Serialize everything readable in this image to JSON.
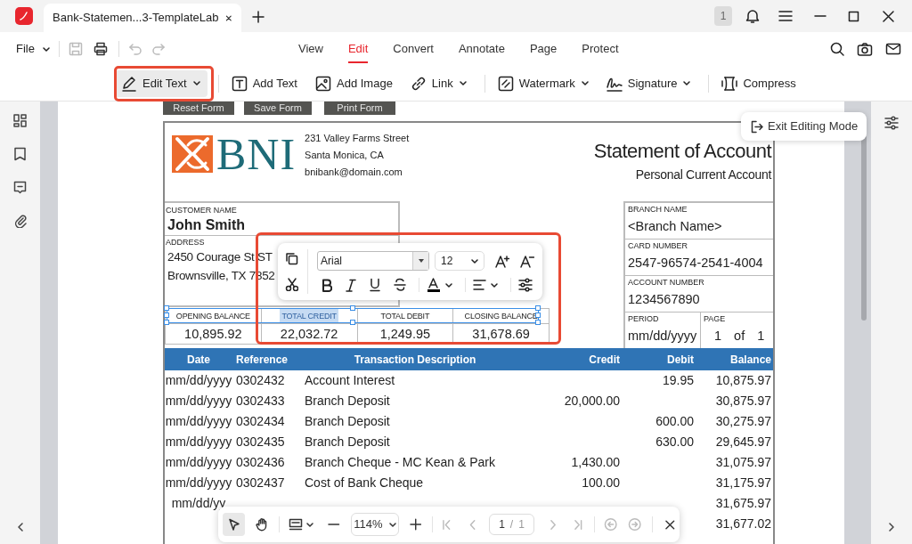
{
  "tab": {
    "title": "Bank-Statemen...3-TemplateLab",
    "notification_count": "1"
  },
  "menu": {
    "file": "File",
    "tabs": [
      {
        "label": "View",
        "selected": false
      },
      {
        "label": "Edit",
        "selected": true
      },
      {
        "label": "Convert",
        "selected": false
      },
      {
        "label": "Annotate",
        "selected": false
      },
      {
        "label": "Page",
        "selected": false
      },
      {
        "label": "Protect",
        "selected": false
      }
    ]
  },
  "toolbar": [
    {
      "label": "Edit Text",
      "kind": "pencil",
      "dropdown": true,
      "selected": true
    },
    {
      "label": "Add Text",
      "kind": "textbox",
      "dropdown": false,
      "selected": false
    },
    {
      "label": "Add Image",
      "kind": "image",
      "dropdown": false,
      "selected": false
    },
    {
      "label": "Link",
      "kind": "link",
      "dropdown": true,
      "selected": false
    },
    {
      "label": "Watermark",
      "kind": "watermark",
      "dropdown": true,
      "selected": false
    },
    {
      "label": "Signature",
      "kind": "signature",
      "dropdown": true,
      "selected": false
    },
    {
      "label": "Compress",
      "kind": "compress",
      "dropdown": false,
      "selected": false
    }
  ],
  "exit_button": "Exit Editing Mode",
  "document": {
    "form_buttons": [
      "Reset Form",
      "Save Form",
      "Print Form"
    ],
    "bank_logo": "BNI",
    "bank_address": [
      "231 Valley Farms Street",
      "Santa Monica, CA",
      "bnibank@domain.com"
    ],
    "title": "Statement of Account",
    "subtitle": "Personal Current Account",
    "customer": {
      "name_label": "CUSTOMER NAME",
      "name": "John Smith",
      "address_label": "ADDRESS",
      "address_lines": [
        "2450 Courage St ST",
        "Brownsville, TX 7852"
      ]
    },
    "branch": [
      {
        "label": "BRANCH NAME",
        "value": "<Branch Name>"
      },
      {
        "label": "CARD NUMBER",
        "value": "2547-96574-2541-4004"
      },
      {
        "label": "ACCOUNT NUMBER",
        "value": "1234567890"
      }
    ],
    "period": {
      "label": "PERIOD",
      "value": "mm/dd/yyyy"
    },
    "page": {
      "label": "PAGE",
      "current": "1",
      "of": "of",
      "total": "1"
    },
    "balances": [
      {
        "label": "OPENING BALANCE",
        "value": "10,895.92",
        "highlighted": false
      },
      {
        "label": "TOTAL CREDIT",
        "value": "22,032.72",
        "highlighted": true
      },
      {
        "label": "TOTAL DEBIT",
        "value": "1,249.95",
        "highlighted": false
      },
      {
        "label": "CLOSING BALANCE",
        "value": "31,678.69",
        "highlighted": false
      }
    ],
    "columns": [
      "Date",
      "Reference",
      "Transaction Description",
      "Credit",
      "Debit",
      "Balance"
    ],
    "rows": [
      {
        "date": "mm/dd/yyyy",
        "reference": "0302432",
        "description": "Account Interest",
        "debit": "19.95",
        "balance": "10,875.97"
      },
      {
        "date": "mm/dd/yyyy",
        "reference": "0302433",
        "description": "Branch Deposit",
        "credit": "20,000.00",
        "balance": "30,875.97"
      },
      {
        "date": "mm/dd/yyyy",
        "reference": "0302434",
        "description": "Branch Deposit",
        "debit": "600.00",
        "balance": "30,275.97"
      },
      {
        "date": "mm/dd/yyyy",
        "reference": "0302435",
        "description": "Branch Deposit",
        "debit": "630.00",
        "balance": "29,645.97"
      },
      {
        "date": "mm/dd/yyyy",
        "reference": "0302436",
        "description": "Branch Cheque - MC Kean & Park",
        "credit": "1,430.00",
        "balance": "31,075.97"
      },
      {
        "date": "mm/dd/yyyy",
        "reference": "0302437",
        "description": "Cost of Bank Cheque",
        "credit": "100.00",
        "balance": "31,175.97"
      },
      {
        "date": "mm/dd/yy",
        "balance": "31,675.97"
      },
      {
        "balance": "31,677.02"
      }
    ]
  },
  "format_popup": {
    "font": "Arial",
    "size": "12"
  },
  "bottom_bar": {
    "zoom": "114%",
    "page": "1",
    "separator": "/",
    "total": "1"
  }
}
